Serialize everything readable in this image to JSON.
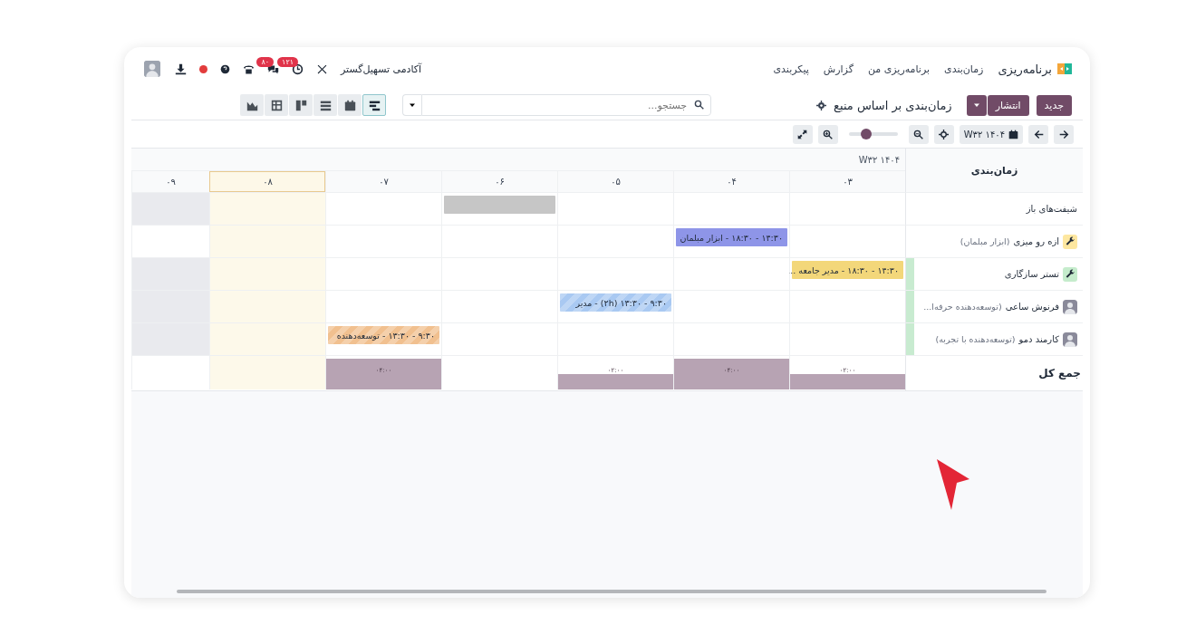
{
  "navbar": {
    "app_name": "برنامه‌ریزی",
    "menu": [
      "زمان‌بندی",
      "برنامه‌ریزی من",
      "گزارش",
      "پیکربندی"
    ],
    "activity_badge": "۱۲۱",
    "message_badge": "۸۰",
    "company": "آکادمی تسهیل‌گستر"
  },
  "control_panel": {
    "new_button": "جدید",
    "publish_button": "انتشار",
    "title": "زمان‌بندی بر اساس منبع",
    "search": {
      "placeholder": "جستجو..."
    },
    "views": [
      {
        "kind": "gantt",
        "selected": true
      },
      {
        "kind": "calendar",
        "selected": false
      },
      {
        "kind": "list",
        "selected": false
      },
      {
        "kind": "kanban",
        "selected": false
      },
      {
        "kind": "pivot",
        "selected": false
      },
      {
        "kind": "graph",
        "selected": false
      }
    ]
  },
  "toolbar": {
    "period": "W۳۲ ۱۴۰۴",
    "zoom": {
      "level": 0.35
    }
  },
  "gantt": {
    "corner": "زمان‌بندی",
    "week": "W۳۲ ۱۴۰۴",
    "days": [
      {
        "label": "۰۳",
        "today": false,
        "total": "۰۲:۰۰"
      },
      {
        "label": "۰۴",
        "today": false,
        "total": "۰۴:۰۰"
      },
      {
        "label": "۰۵",
        "today": false,
        "total": "۰۲:۰۰"
      },
      {
        "label": "۰۶",
        "today": false
      },
      {
        "label": "۰۷",
        "today": false,
        "total": "۰۴:۰۰"
      },
      {
        "label": "۰۸",
        "today": true
      },
      {
        "label": "۰۹",
        "today": false
      }
    ],
    "rows": [
      {
        "name": "شیفت‌های باز",
        "kind": "group",
        "cells": [
          {
            "off": false
          },
          {
            "off": false
          },
          {
            "off": false
          },
          {
            "off": false,
            "shift": {
              "color": "#c6c6c6",
              "striped": false
            }
          },
          {
            "off": false
          },
          {
            "off": false
          },
          {
            "off": true
          }
        ]
      },
      {
        "name": "ازه رو میزی",
        "detail": "(ابزار مبلمان)",
        "kind": "material",
        "color": "#fde7a0",
        "cells": [
          {
            "off": false
          },
          {
            "off": false,
            "shift": {
              "text": "۱۴:۳۰ - ۱۸:۳۰ - ابزار مبلمان",
              "color": "#8e95e8",
              "striped": false
            }
          },
          {
            "off": false
          },
          {
            "off": false
          },
          {
            "off": false
          },
          {
            "off": false
          },
          {
            "off": false
          }
        ]
      },
      {
        "name": "تستر سازگاری",
        "kind": "material",
        "color": "#c5eccc",
        "available": true,
        "cells": [
          {
            "off": false,
            "shift": {
              "text": "۱۴:۳۰ - ۱۸:۳۰ - مدیر جامعه ...",
              "color": "#f3d77a",
              "striped": false
            }
          },
          {
            "off": false
          },
          {
            "off": false
          },
          {
            "off": false
          },
          {
            "off": false
          },
          {
            "off": false
          },
          {
            "off": true
          }
        ]
      },
      {
        "name": "فرنوش ساعی",
        "detail": "(توسعه‌دهنده حرفه‌ا...",
        "kind": "employee",
        "available": true,
        "cells": [
          {
            "off": false
          },
          {
            "off": false
          },
          {
            "off": false,
            "shift": {
              "text": "۹:۳۰ - ۱۳:۳۰ (۲h) - مدیر",
              "color": "#a9c9f2",
              "striped": true
            }
          },
          {
            "off": false
          },
          {
            "off": false
          },
          {
            "off": false
          },
          {
            "off": true
          }
        ]
      },
      {
        "name": "کارمند دمو",
        "detail": "(توسعه‌دهنده با تجربه)",
        "kind": "employee",
        "available": true,
        "cells": [
          {
            "off": false
          },
          {
            "off": false
          },
          {
            "off": false
          },
          {
            "off": false
          },
          {
            "off": false,
            "shift": {
              "text": "۹:۳۰ - ۱۳:۳۰ - توسعه‌دهنده",
              "color": "#f1c08f",
              "striped": true
            }
          },
          {
            "off": false
          },
          {
            "off": true
          }
        ]
      }
    ],
    "total_label": "جمع کل"
  }
}
